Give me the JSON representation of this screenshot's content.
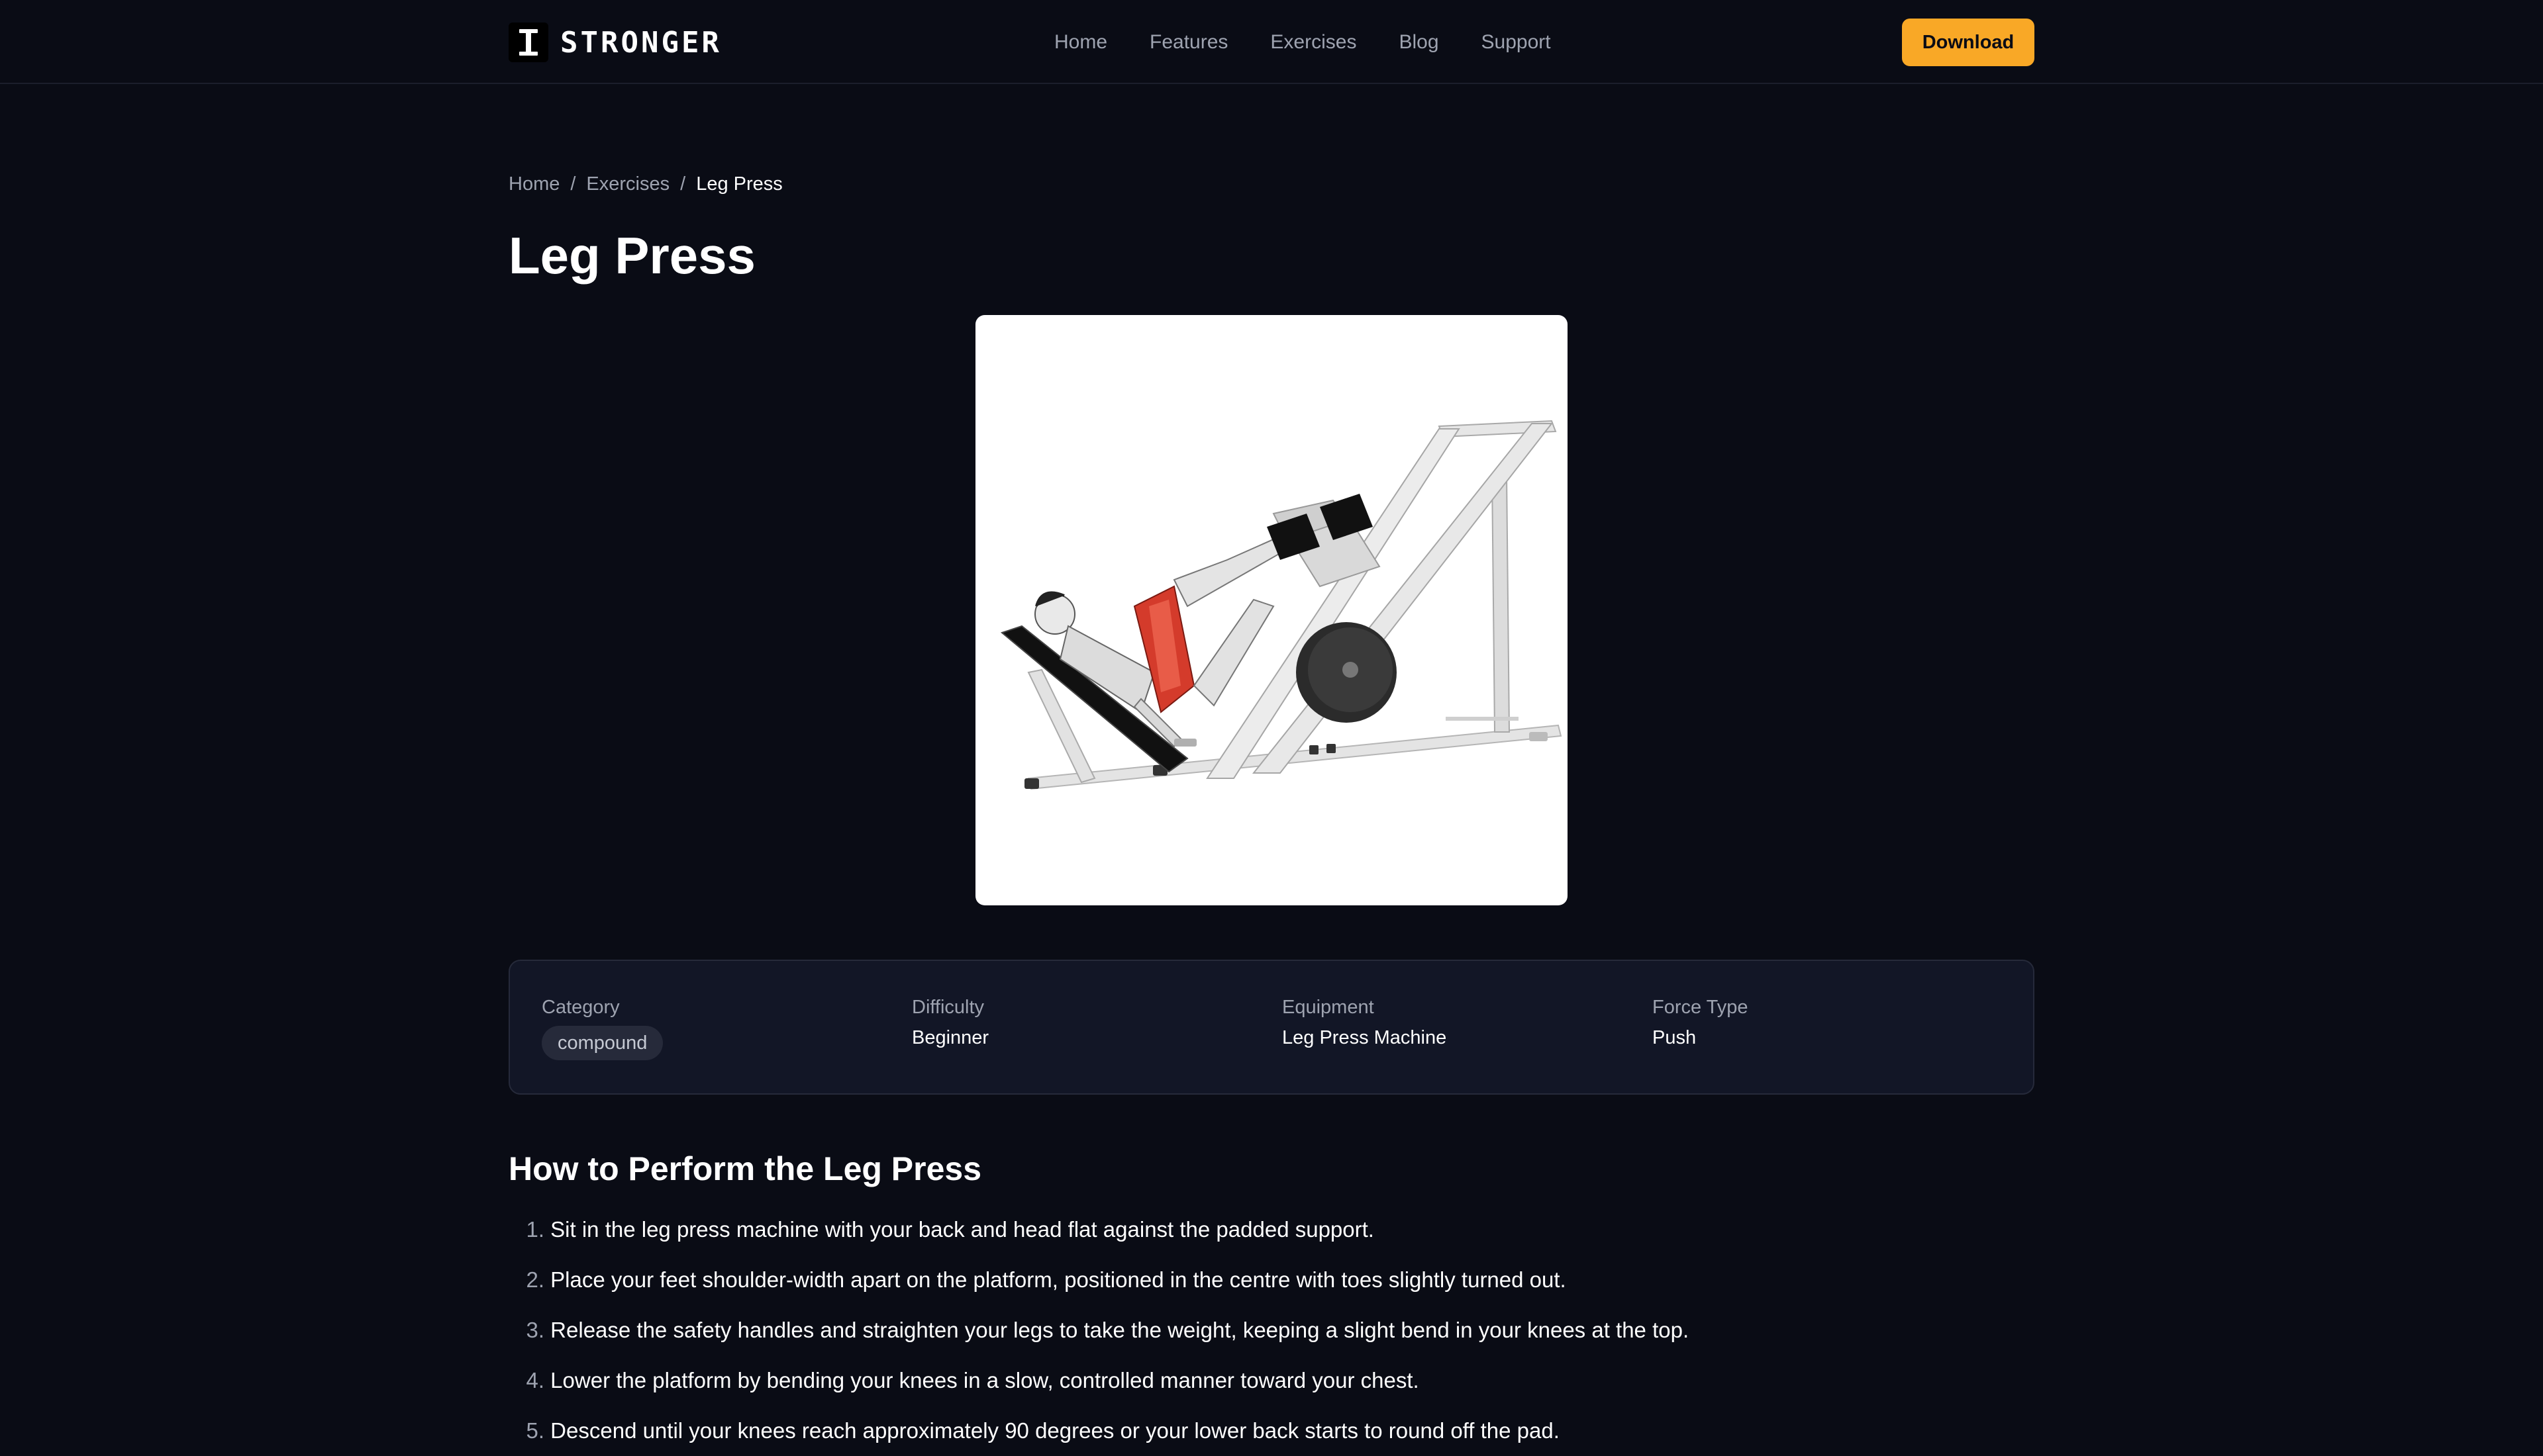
{
  "header": {
    "logo_text": "STRONGER",
    "nav": [
      {
        "label": "Home"
      },
      {
        "label": "Features"
      },
      {
        "label": "Exercises"
      },
      {
        "label": "Blog"
      },
      {
        "label": "Support"
      }
    ],
    "download_label": "Download"
  },
  "breadcrumb": {
    "items": [
      {
        "label": "Home"
      },
      {
        "label": "Exercises"
      }
    ],
    "separator": "/",
    "current": "Leg Press"
  },
  "page": {
    "title": "Leg Press",
    "image_icon": "leg-press-illustration"
  },
  "info": {
    "category_label": "Category",
    "category_value": "compound",
    "difficulty_label": "Difficulty",
    "difficulty_value": "Beginner",
    "equipment_label": "Equipment",
    "equipment_value": "Leg Press Machine",
    "force_label": "Force Type",
    "force_value": "Push"
  },
  "instructions": {
    "title": "How to Perform the Leg Press",
    "steps": [
      {
        "num": "1.",
        "text": "Sit in the leg press machine with your back and head flat against the padded support."
      },
      {
        "num": "2.",
        "text": "Place your feet shoulder-width apart on the platform, positioned in the centre with toes slightly turned out."
      },
      {
        "num": "3.",
        "text": "Release the safety handles and straighten your legs to take the weight, keeping a slight bend in your knees at the top."
      },
      {
        "num": "4.",
        "text": "Lower the platform by bending your knees in a slow, controlled manner toward your chest."
      },
      {
        "num": "5.",
        "text": "Descend until your knees reach approximately 90 degrees or your lower back starts to round off the pad."
      }
    ]
  },
  "colors": {
    "background": "#0a0c15",
    "accent": "#f9a826",
    "card": "#121626",
    "muted_text": "#9ea3b0"
  }
}
